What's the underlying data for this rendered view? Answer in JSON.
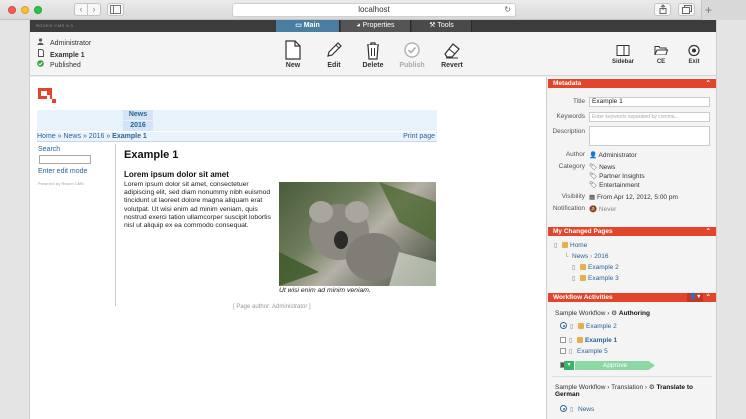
{
  "browser": {
    "url": "localhost",
    "back_glyph": "‹",
    "forward_glyph": "›",
    "newtab_glyph": "+"
  },
  "cms": {
    "brand": "ROXEN CMS 6.0",
    "tabs": [
      {
        "label": "Main",
        "active": true,
        "icon": "monitor-icon"
      },
      {
        "label": "Properties",
        "active": false,
        "icon": "palette-icon"
      },
      {
        "label": "Tools",
        "active": false,
        "icon": "wrench-icon"
      }
    ]
  },
  "toolbar": {
    "user": "Administrator",
    "page": "Example 1",
    "status": "Published",
    "tools": {
      "new": "New",
      "edit": "Edit",
      "delete": "Delete",
      "publish": "Publish",
      "revert": "Revert",
      "sidebar": "Sidebar",
      "ce": "CE",
      "exit": "Exit"
    }
  },
  "preview": {
    "nav": [
      "News",
      "2016"
    ],
    "breadcrumb": {
      "items": [
        "Home",
        "News",
        "2016"
      ],
      "separator": " » ",
      "current": "Example 1",
      "print": "Print page"
    },
    "left": {
      "search_label": "Search",
      "edit_mode": "Enter edit mode",
      "powered_by": "Powered by Roxen CMS"
    },
    "article": {
      "title": "Example 1",
      "subtitle": "Lorem ipsum dolor sit amet",
      "body": "Lorem ipsum dolor sit amet, consectetuer adipiscing elit, sed diam nonummy nibh euismod tincidunt ut laoreet dolore magna aliquam erat volutpat. Ut wisi enim ad minim veniam, quis nostrud exerci tation ullamcorper suscipit lobortis nisl ut aliquip ex ea commodo consequat.",
      "caption": "Ut wisi enim ad minim veniam.",
      "page_author": "[ Page author: Administrator ]"
    }
  },
  "sidebar": {
    "metadata": {
      "heading": "Metadata",
      "title_label": "Title",
      "title_value": "Example 1",
      "keywords_label": "Keywords",
      "keywords_placeholder": "Enter keywords separated by comma...",
      "description_label": "Description",
      "author_label": "Author",
      "author_value": "Administrator",
      "category_label": "Category",
      "categories": [
        "News",
        "Partner Insights",
        "Entertainment"
      ],
      "visibility_label": "Visibility",
      "visibility_value": "From Apr 12, 2012, 5:00 pm",
      "notification_label": "Notification",
      "notification_value": "Never"
    },
    "changed": {
      "heading": "My Changed Pages",
      "items": [
        {
          "path": "Home"
        },
        {
          "path": "News",
          "extra": "2016"
        },
        {
          "path": "Example 2"
        },
        {
          "path": "Example 3"
        }
      ]
    },
    "workflow": {
      "heading": "Workflow Activities",
      "wf1": {
        "name": "Sample Workflow",
        "sep": "›",
        "step": "Authoring"
      },
      "wf1_items": [
        "Example 2",
        "Example 1",
        "Example 5"
      ],
      "approve": "Approve",
      "wf2": {
        "name": "Sample Workflow",
        "sub": "Translation",
        "sep": "›",
        "step": "Translate to German"
      },
      "wf2_items": [
        "News"
      ]
    }
  }
}
